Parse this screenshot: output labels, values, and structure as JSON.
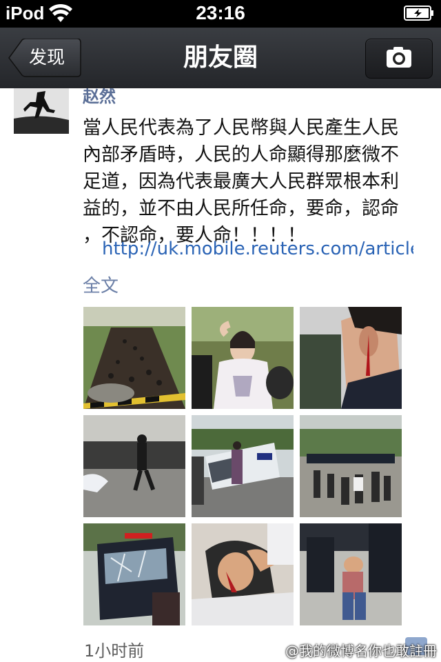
{
  "status_bar": {
    "carrier": "iPod",
    "time": "23:16"
  },
  "nav": {
    "back_label": "发现",
    "title": "朋友圈",
    "camera_icon": "camera-icon"
  },
  "post": {
    "author": "赵然",
    "text": "當人民代表為了人民幣與人民產生人民\n內部矛盾時，人民的人命顯得那麼微不\n足道，因為代表最廣大人民群眾根本利\n益的，並不由人民所任命，要命，認命\n，不認命，要人命！！！！",
    "link": "http://uk.mobile.reuters.com/article...",
    "full_text_label": "全文",
    "photos": [
      {
        "id": "photo-crowd-road"
      },
      {
        "id": "photo-woman-injured"
      },
      {
        "id": "photo-bleeding-ear"
      },
      {
        "id": "photo-police-running"
      },
      {
        "id": "photo-overturned-car"
      },
      {
        "id": "photo-police-line"
      },
      {
        "id": "photo-damaged-truck"
      },
      {
        "id": "photo-injured-man"
      },
      {
        "id": "photo-man-detained"
      }
    ],
    "time_ago": "1小时前"
  },
  "watermark": "@我的微博名你也敢註冊",
  "colors": {
    "navbar": "#2e3035",
    "link": "#2a63b5",
    "author": "#5b6f97"
  }
}
